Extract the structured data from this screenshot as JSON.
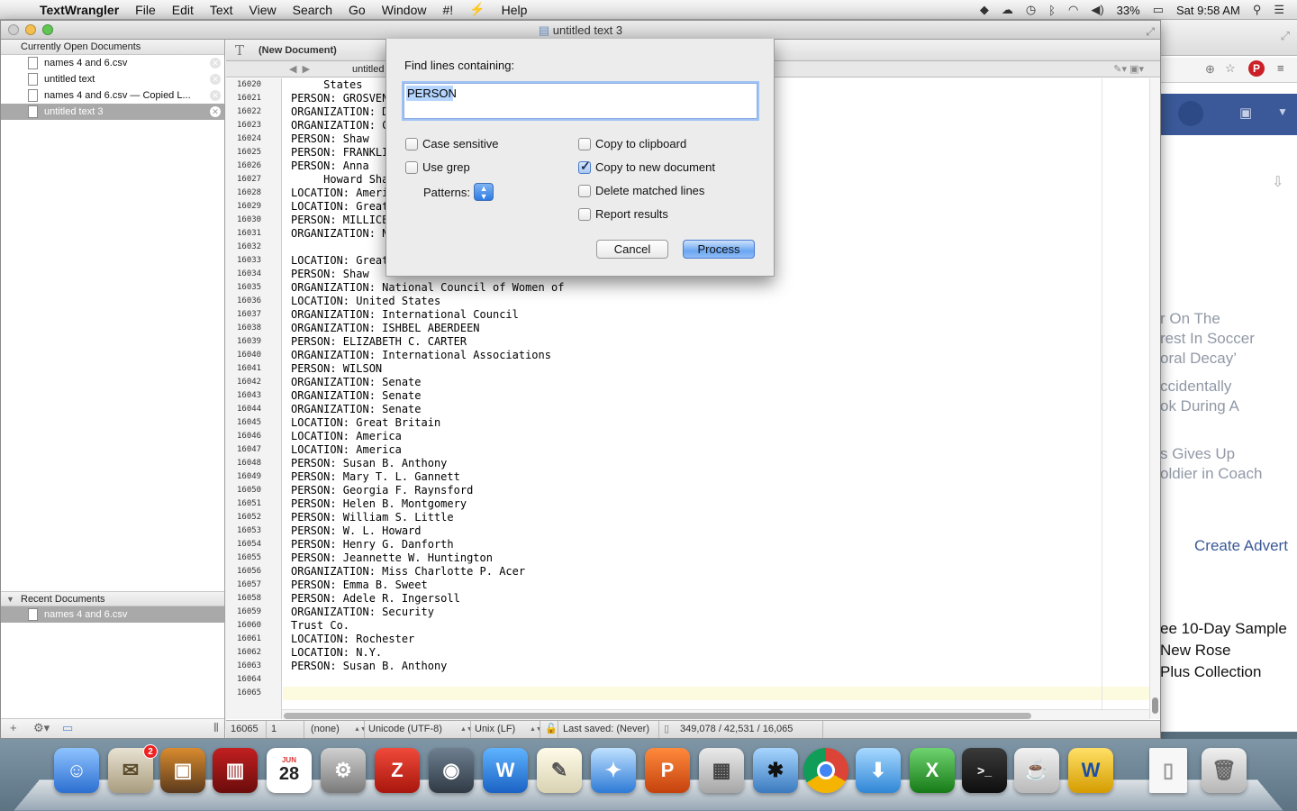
{
  "menubar": {
    "app_name": "TextWrangler",
    "items": [
      "File",
      "Edit",
      "Text",
      "View",
      "Search",
      "Go",
      "Window",
      "#!",
      "Help"
    ],
    "battery": "33%",
    "clock": "Sat 9:58 AM"
  },
  "window": {
    "title": "untitled text 3"
  },
  "sidebar": {
    "open_header": "Currently Open Documents",
    "open_docs": [
      {
        "name": "names 4 and 6.csv",
        "selected": false
      },
      {
        "name": "untitled text",
        "selected": false
      },
      {
        "name": "names 4 and 6.csv — Copied L...",
        "selected": false
      },
      {
        "name": "untitled text 3",
        "selected": true
      }
    ],
    "recent_header": "Recent Documents",
    "recent_docs": [
      {
        "name": "names 4 and 6.csv",
        "selected": true
      }
    ]
  },
  "editor": {
    "nav_title": "(New Document)",
    "tab_title": "untitled",
    "line_numbers": [
      "16020",
      "16021",
      "16022",
      "16023",
      "16024",
      "16025",
      "16026",
      "16027",
      "16028",
      "16029",
      "16030",
      "16031",
      "16032",
      "16033",
      "16034",
      "16035",
      "16036",
      "16037",
      "16038",
      "16039",
      "16040",
      "16041",
      "16042",
      "16043",
      "16044",
      "16045",
      "16046",
      "16047",
      "16048",
      "16049",
      "16050",
      "16051",
      "16052",
      "16053",
      "16054",
      "16055",
      "16056",
      "16057",
      "16058",
      "16059",
      "16060",
      "16061",
      "16062",
      "16063",
      "16064",
      "16065"
    ],
    "lines": [
      "     States",
      "PERSON: GROSVEN",
      "ORGANIZATION: D",
      "ORGANIZATION: C",
      "PERSON: Shaw",
      "PERSON: FRANKLI",
      "PERSON: Anna",
      "     Howard Sha",
      "LOCATION: Ameri",
      "LOCATION: Great",
      "PERSON: MILLICE",
      "ORGANIZATION: N",
      "",
      "LOCATION: Great",
      "PERSON: Shaw",
      "ORGANIZATION: National Council of Women of",
      "LOCATION: United States",
      "ORGANIZATION: International Council",
      "ORGANIZATION: ISHBEL ABERDEEN",
      "PERSON: ELIZABETH C. CARTER",
      "ORGANIZATION: International Associations",
      "PERSON: WILSON",
      "ORGANIZATION: Senate",
      "ORGANIZATION: Senate",
      "ORGANIZATION: Senate",
      "LOCATION: Great Britain",
      "LOCATION: America",
      "LOCATION: America",
      "PERSON: Susan B. Anthony",
      "PERSON: Mary T. L. Gannett",
      "PERSON: Georgia F. Raynsford",
      "PERSON: Helen B. Montgomery",
      "PERSON: William S. Little",
      "PERSON: W. L. Howard",
      "PERSON: Henry G. Danforth",
      "PERSON: Jeannette W. Huntington",
      "ORGANIZATION: Miss Charlotte P. Acer",
      "PERSON: Emma B. Sweet",
      "PERSON: Adele R. Ingersoll",
      "ORGANIZATION: Security",
      "Trust Co.",
      "LOCATION: Rochester",
      "LOCATION: N.Y.",
      "PERSON: Susan B. Anthony",
      "",
      ""
    ]
  },
  "statusbar": {
    "line": "16065",
    "column": "1",
    "language": "(none)",
    "encoding": "Unicode (UTF-8)",
    "line_endings": "Unix (LF)",
    "last_saved": "Last saved: (Never)",
    "counts": "349,078 / 42,531 / 16,065"
  },
  "find_dialog": {
    "title": "Find lines containing:",
    "search_value": "PERSON",
    "case_sensitive_label": "Case sensitive",
    "case_sensitive": false,
    "use_grep_label": "Use grep",
    "use_grep": false,
    "patterns_label": "Patterns:",
    "copy_clipboard_label": "Copy to clipboard",
    "copy_clipboard": false,
    "copy_new_doc_label": "Copy to new document",
    "copy_new_doc": true,
    "delete_lines_label": "Delete matched lines",
    "delete_lines": false,
    "report_results_label": "Report results",
    "report_results": false,
    "cancel_label": "Cancel",
    "process_label": "Process"
  },
  "browser": {
    "headlines": [
      "r On The",
      "rest In Soccer",
      "oral Decay’",
      "ccidentally",
      "ok During A",
      "s Gives Up",
      "oldier in Coach"
    ],
    "create_label": "Create Advert",
    "promo_lines": [
      "ee 10-Day Sample",
      "New Rose",
      "Plus Collection"
    ]
  },
  "dock": {
    "mail_badge": "2",
    "calendar_month": "JUN",
    "calendar_day": "28"
  },
  "colors": {
    "accent": "#3b82f0",
    "facebook": "#3b5998",
    "selection": "#a9a9a9"
  }
}
